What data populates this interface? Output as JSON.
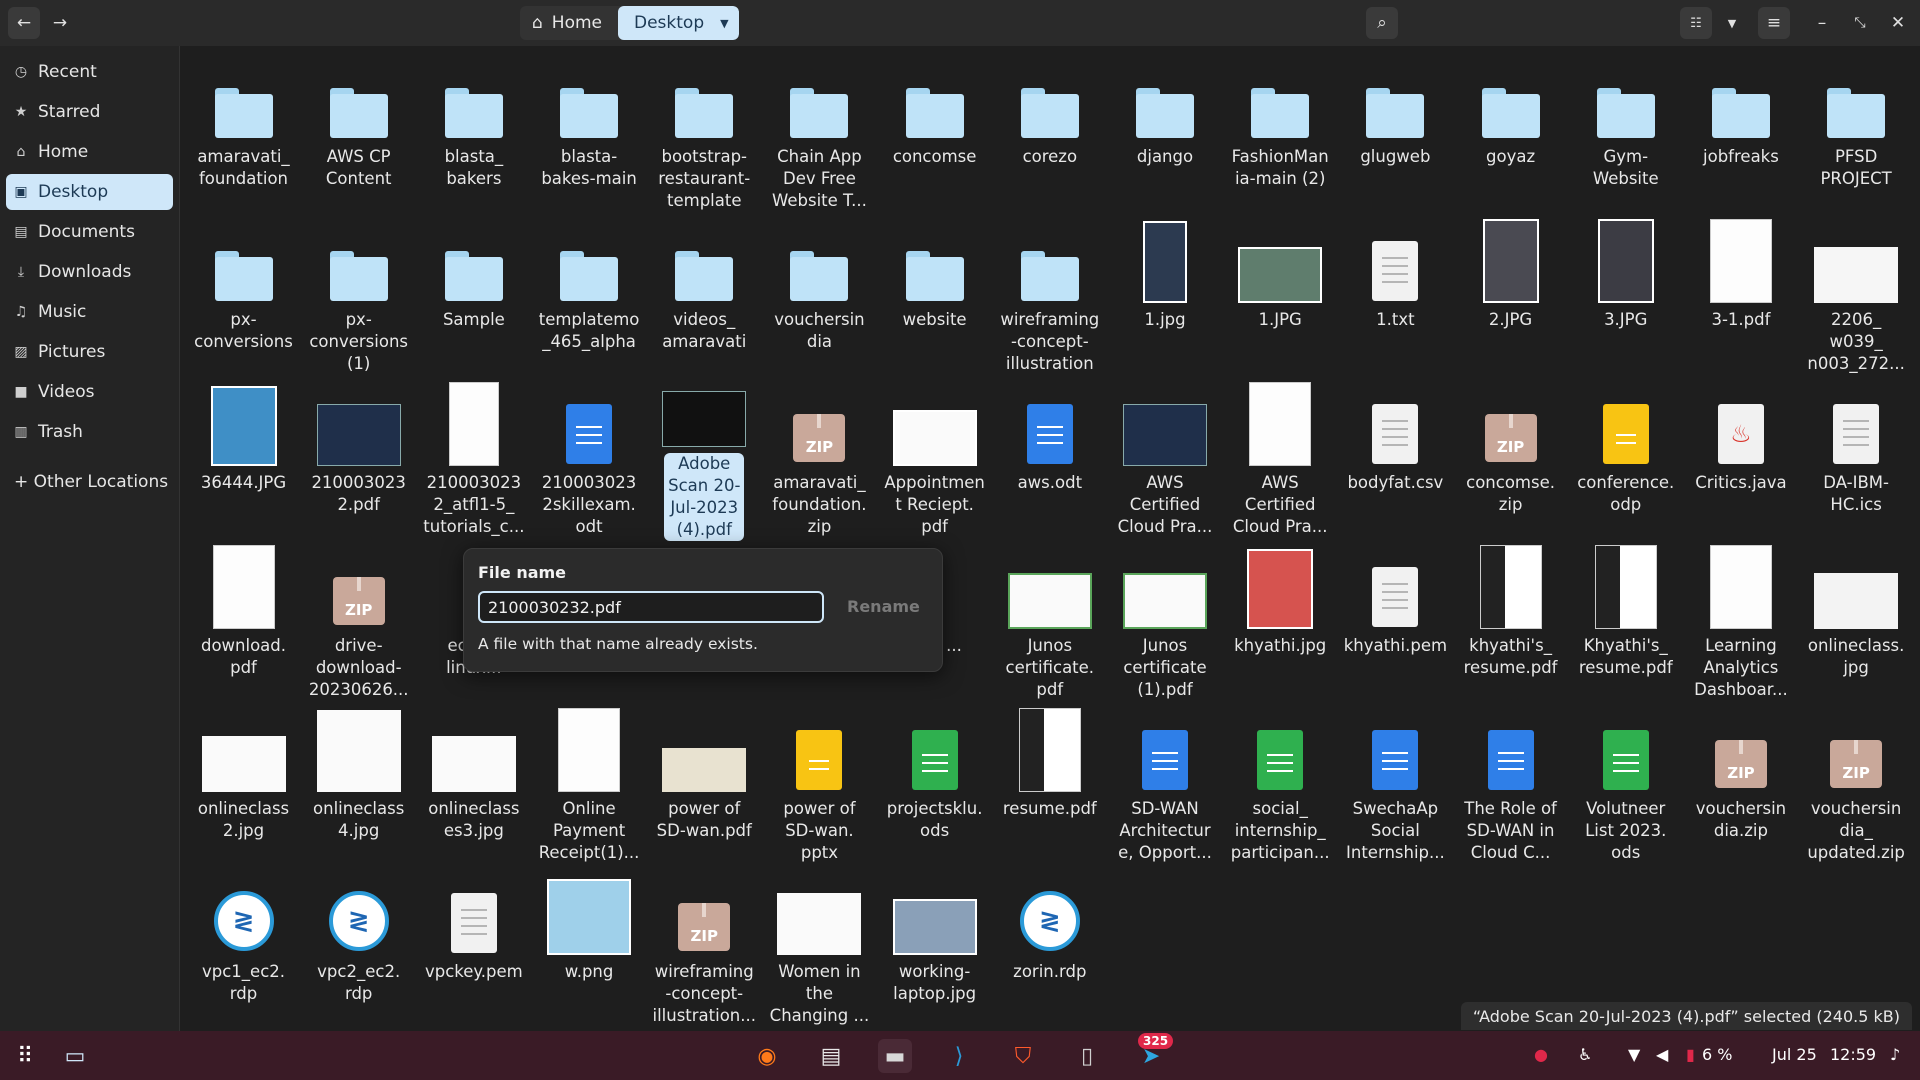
{
  "header": {
    "path_home": "Home",
    "path_current": "Desktop"
  },
  "sidebar": {
    "items": [
      {
        "label": "Recent",
        "icon": "clock-icon"
      },
      {
        "label": "Starred",
        "icon": "star-icon"
      },
      {
        "label": "Home",
        "icon": "home-icon"
      },
      {
        "label": "Desktop",
        "icon": "desktop-icon"
      },
      {
        "label": "Documents",
        "icon": "document-icon"
      },
      {
        "label": "Downloads",
        "icon": "download-icon"
      },
      {
        "label": "Music",
        "icon": "music-icon"
      },
      {
        "label": "Pictures",
        "icon": "picture-icon"
      },
      {
        "label": "Videos",
        "icon": "video-icon"
      },
      {
        "label": "Trash",
        "icon": "trash-icon"
      }
    ],
    "other_locations": "+ Other Locations"
  },
  "files": [
    "amaravati_ foundation",
    "AWS CP Content",
    "blasta_ bakers",
    "blasta- bakes-main",
    "bootstrap- restaurant- template",
    "Chain App Dev Free Website T...",
    "concomse",
    "corezo",
    "django",
    "FashionMan ia-main (2)",
    "glugweb",
    "goyaz",
    "Gym- Website",
    "jobfreaks",
    "PFSD PROJECT",
    "px- conversions",
    "px- conversions (1)",
    "Sample",
    "templatemo _465_alpha",
    "videos_ amaravati",
    "vouchersin dia",
    "website",
    "wireframing -concept- illustration",
    "1.jpg",
    "1.JPG",
    "1.txt",
    "2.JPG",
    "3.JPG",
    "3-1.pdf",
    "2206_ w039_ n003_272...",
    "36444.JPG",
    "210003023 2.pdf",
    "210003023 2_atfl1-5_ tutorials_c...",
    "210003023 2skillexam. odt",
    "Adobe Scan 20- Jul-2023 (4).pdf",
    "amaravati_ foundation. zip",
    "Appointmen t Reciept. pdf",
    "aws.odt",
    "AWS Certified Cloud Pra...",
    "AWS Certified Cloud Pra...",
    "bodyfat.csv",
    "concomse. zip",
    "conference. odp",
    "Critics.java",
    "DA-IBM- HC.ics",
    "download. pdf",
    "drive- download- 20230626...",
    "ecl ins linux...",
    "",
    "",
    "",
    "aks. ...",
    "Junos certificate. pdf",
    "Junos certificate (1).pdf",
    "khyathi.jpg",
    "khyathi.pem",
    "khyathi's_ resume.pdf",
    "Khyathi's_ resume.pdf",
    "Learning Analytics Dashboar...",
    "onlineclass. jpg",
    "onlineclass 2.jpg",
    "onlineclass 4.jpg",
    "onlineclass es3.jpg",
    "Online Payment Receipt(1)...",
    "power of SD-wan.pdf",
    "power of SD-wan. pptx",
    "projectsklu. ods",
    "resume.pdf",
    "SD-WAN Architectur e, Opport...",
    "social_ internship_ participan...",
    "SwechaAp Social Internship...",
    "The Role of SD-WAN in Cloud C...",
    "Volutneer List 2023. ods",
    "vouchersin dia.zip",
    "vouchersin dia_ updated.zip",
    "vpc1_ec2. rdp",
    "vpc2_ec2. rdp",
    "vpckey.pem",
    "w.png",
    "wireframing -concept- illustration...",
    "Women in the Changing ...",
    "working- laptop.jpg",
    "zorin.rdp"
  ],
  "rename": {
    "title": "File name",
    "value": "2100030232.pdf",
    "button": "Rename",
    "message": "A file with that name already exists."
  },
  "status": "“Adobe Scan 20-Jul-2023 (4).pdf” selected (240.5 kB)",
  "taskbar": {
    "badge": "325",
    "battery": "6 %",
    "date": "Jul 25",
    "time": "12:59"
  },
  "colors": {
    "accent": "#cfe7f9",
    "taskbar": "#3a1b26",
    "folder": "#bfe3f8"
  }
}
